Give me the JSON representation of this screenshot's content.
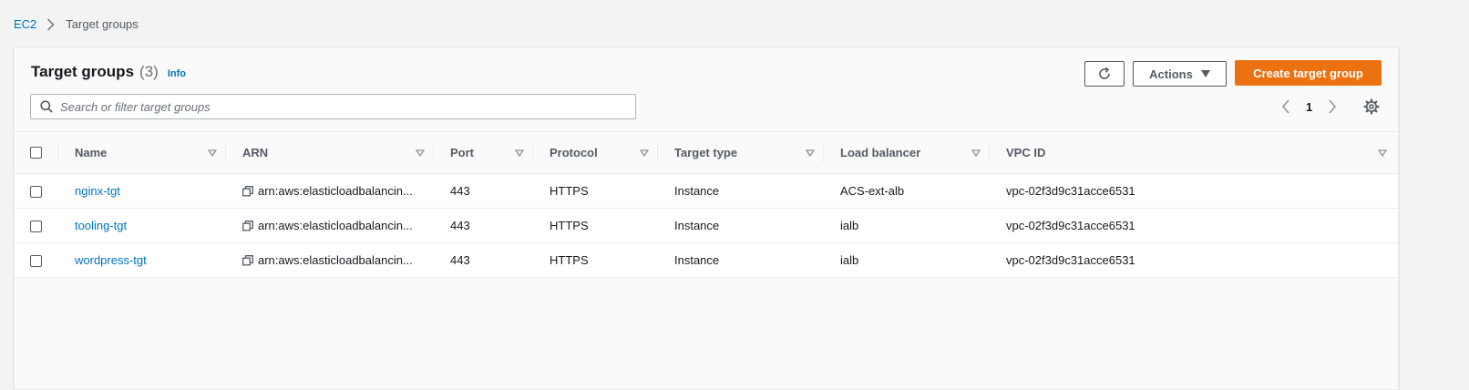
{
  "breadcrumb": {
    "root": "EC2",
    "current": "Target groups"
  },
  "header": {
    "title": "Target groups",
    "count": "(3)",
    "info": "Info",
    "actions_label": "Actions",
    "create_label": "Create target group"
  },
  "search": {
    "placeholder": "Search or filter target groups",
    "value": ""
  },
  "pagination": {
    "current_page": "1"
  },
  "table": {
    "columns": [
      "Name",
      "ARN",
      "Port",
      "Protocol",
      "Target type",
      "Load balancer",
      "VPC ID"
    ],
    "rows": [
      {
        "name": "nginx-tgt",
        "arn": "arn:aws:elasticloadbalancin...",
        "port": "443",
        "protocol": "HTTPS",
        "target_type": "Instance",
        "load_balancer": "ACS-ext-alb",
        "vpc_id": "vpc-02f3d9c31acce6531"
      },
      {
        "name": "tooling-tgt",
        "arn": "arn:aws:elasticloadbalancin...",
        "port": "443",
        "protocol": "HTTPS",
        "target_type": "Instance",
        "load_balancer": "ialb",
        "vpc_id": "vpc-02f3d9c31acce6531"
      },
      {
        "name": "wordpress-tgt",
        "arn": "arn:aws:elasticloadbalancin...",
        "port": "443",
        "protocol": "HTTPS",
        "target_type": "Instance",
        "load_balancer": "ialb",
        "vpc_id": "vpc-02f3d9c31acce6531"
      }
    ]
  },
  "colors": {
    "link": "#0073bb",
    "primary_button": "#ec7211",
    "page_background": "#f2f3f3"
  },
  "icons": [
    "chevron-right-icon",
    "refresh-icon",
    "caret-down-icon",
    "search-icon",
    "chevron-left-icon",
    "gear-icon",
    "sort-icon",
    "copy-icon"
  ]
}
